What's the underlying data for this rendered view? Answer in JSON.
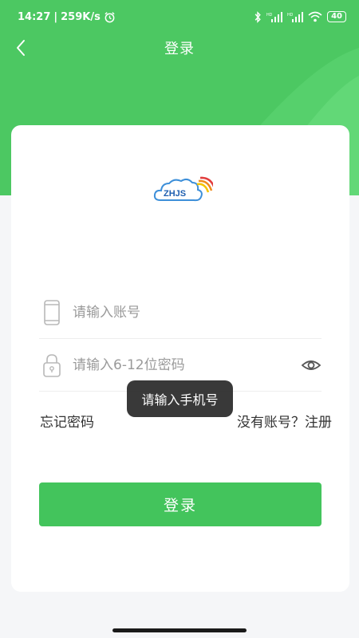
{
  "status_bar": {
    "time": "14:27",
    "separator": "|",
    "speed": "259K/s",
    "battery": "40",
    "icons": [
      "alarm-icon",
      "bluetooth-icon",
      "signal-hd-icon",
      "signal-hd-icon",
      "wifi-icon",
      "battery-icon"
    ]
  },
  "navbar": {
    "title": "登录",
    "back_icon": "chevron-left-icon"
  },
  "logo": {
    "text": "ZHJS"
  },
  "form": {
    "account_placeholder": "请输入账号",
    "password_placeholder": "请输入6-12位密码",
    "forgot_label": "忘记密码",
    "register_label": "没有账号？注册",
    "login_label": "登录"
  },
  "toast": {
    "text": "请输入手机号"
  },
  "colors": {
    "brand_green": "#43c45c",
    "hero_green": "#4cc862",
    "background": "#f5f6f8"
  }
}
